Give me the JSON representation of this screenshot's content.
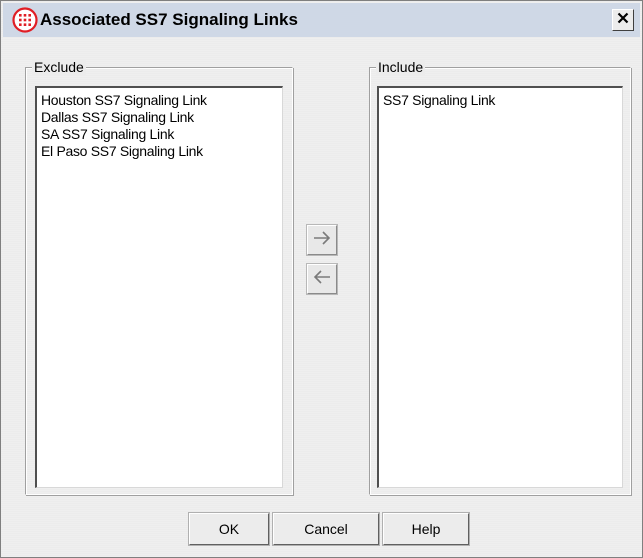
{
  "window": {
    "title": "Associated SS7 Signaling Links",
    "close_glyph": "✕"
  },
  "exclude": {
    "label": "Exclude",
    "items": [
      "Houston SS7 Signaling Link",
      "Dallas SS7 Signaling Link",
      "SA SS7 Signaling Link",
      "El Paso SS7 Signaling Link"
    ]
  },
  "include": {
    "label": "Include",
    "items": [
      "SS7 Signaling Link"
    ]
  },
  "buttons": {
    "ok": "OK",
    "cancel": "Cancel",
    "help": "Help"
  },
  "icons": {
    "app": "globe-grid-icon",
    "move_right": "arrow-right-icon",
    "move_left": "arrow-left-icon",
    "close": "close-icon"
  },
  "colors": {
    "titlebar": "#cfd8e6",
    "app_icon": "#e01e25",
    "dialog_bg": "#ececec",
    "arrow_glyph": "#7a7a7a"
  }
}
